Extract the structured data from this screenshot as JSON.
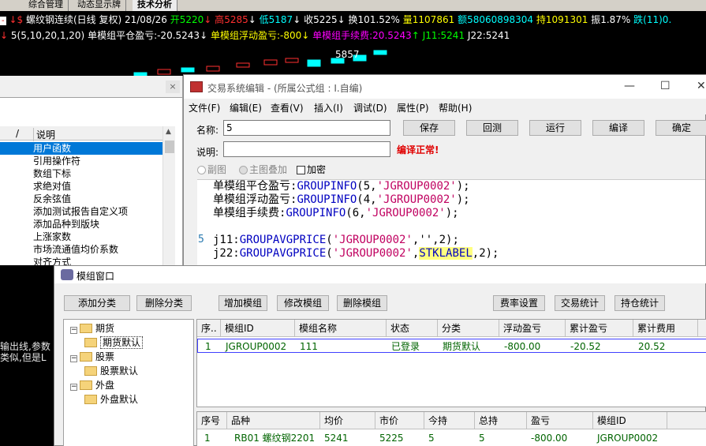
{
  "tabs": [
    "综合管理",
    "动态显示牌",
    "技术分析"
  ],
  "quote": {
    "name": "螺纹钢连续(日线 复权)",
    "date": "21/08/26",
    "open_label": "开",
    "open": "5220",
    "high_label": "高",
    "high": "5285",
    "low_label": "低",
    "low": "5187",
    "close_label": "收",
    "close": "5225",
    "turnover_label": "换",
    "turnover": "101.52%",
    "volume_label": "量",
    "volume": "1107861",
    "amount_label": "额",
    "amount": "58060898304",
    "oi_label": "持",
    "oi": "1091301",
    "amp_label": "振",
    "amp": "1.87%",
    "change_label": "跌",
    "change": "(11)0."
  },
  "indicator": {
    "params": "5(5,10,20,1,20)",
    "closed_pl": "单模组平仓盈亏:-20.5243",
    "float_pl": "单模组浮动盈亏:-800",
    "fee": "单模组手续费:20.5243",
    "j11": "J11:5241",
    "j22": "J22:5241"
  },
  "chart_label": "5857",
  "colors": {
    "up": "#ff3030",
    "down": "#00ffff",
    "yellow": "#ffff00",
    "magenta": "#ff00ff",
    "white": "#ffffff",
    "green": "#00ff00"
  },
  "help": {
    "col1": "/",
    "col2": "说明",
    "items": [
      "用户函数",
      "引用操作符",
      "数组下标",
      "求绝对值",
      "反余弦值",
      "添加测试报告自定义项",
      "添加品种到版块",
      "上涨家数",
      "市场流通值均价系数",
      "对齐方式"
    ]
  },
  "leftnote": [
    "输出线,参数",
    "类似,但是L"
  ],
  "editor": {
    "title": "交易系统编辑 - (所属公式组 : I.自编)",
    "menus": [
      "文件(F)",
      "编辑(E)",
      "查看(V)",
      "插入(I)",
      "调试(D)",
      "属性(P)",
      "帮助(H)"
    ],
    "name_label": "名称:",
    "name_value": "5",
    "desc_label": "说明:",
    "desc_value": "",
    "buttons": [
      "保存",
      "回测",
      "运行",
      "编译",
      "确定"
    ],
    "compile_status": "编译正常!",
    "radio1": "副图",
    "radio2": "主图叠加",
    "check": "加密",
    "code": [
      {
        "pre": "单模组平仓盈亏:",
        "fn": "GROUPINFO",
        "args": "(5,",
        "s": "'JGROUP0002'",
        "end": ");"
      },
      {
        "pre": "单模组浮动盈亏:",
        "fn": "GROUPINFO",
        "args": "(4,",
        "s": "'JGROUP0002'",
        "end": ");"
      },
      {
        "pre": "单模组手续费:",
        "fn": "GROUPINFO",
        "args": "(6,",
        "s": "'JGROUP0002'",
        "end": ");"
      },
      {
        "pre": "",
        "fn": "",
        "args": "",
        "s": "",
        "end": ""
      },
      {
        "pre": "j11:",
        "fn": "GROUPAVGPRICE",
        "args": "(",
        "s": "'JGROUP0002'",
        "end": ",'',2);"
      },
      {
        "pre": "j22:",
        "fn": "GROUPAVGPRICE",
        "args": "(",
        "s": "'JGROUP0002'",
        "end": ",",
        "hl": "STKLABEL",
        "end2": ",2);"
      }
    ],
    "line_number": "5"
  },
  "module": {
    "title": "模组窗口",
    "toolbar": [
      "添加分类",
      "删除分类",
      "增加模组",
      "修改模组",
      "删除模组",
      "费率设置",
      "交易统计",
      "持仓统计"
    ],
    "tree": [
      {
        "label": "期货",
        "level": 0
      },
      {
        "label": "期货默认",
        "level": 1
      },
      {
        "label": "股票",
        "level": 0
      },
      {
        "label": "股票默认",
        "level": 1
      },
      {
        "label": "外盘",
        "level": 0
      },
      {
        "label": "外盘默认",
        "level": 1
      }
    ],
    "grid1_headers": [
      "序..",
      "模组ID",
      "模组名称",
      "状态",
      "分类",
      "浮动盈亏",
      "累计盈亏",
      "累计费用"
    ],
    "grid1_rows": [
      [
        "1",
        "JGROUP0002",
        "111",
        "已登录",
        "期货默认",
        "-800.00",
        "-20.52",
        "20.52"
      ]
    ],
    "grid2_headers": [
      "序号",
      "品种",
      "均价",
      "市价",
      "今持",
      "总持",
      "盈亏",
      "模组ID"
    ],
    "grid2_rows": [
      [
        "1",
        "RB01 螺纹钢2201",
        "5241",
        "5225",
        "5",
        "5",
        "-800.00",
        "JGROUP0002"
      ]
    ]
  }
}
